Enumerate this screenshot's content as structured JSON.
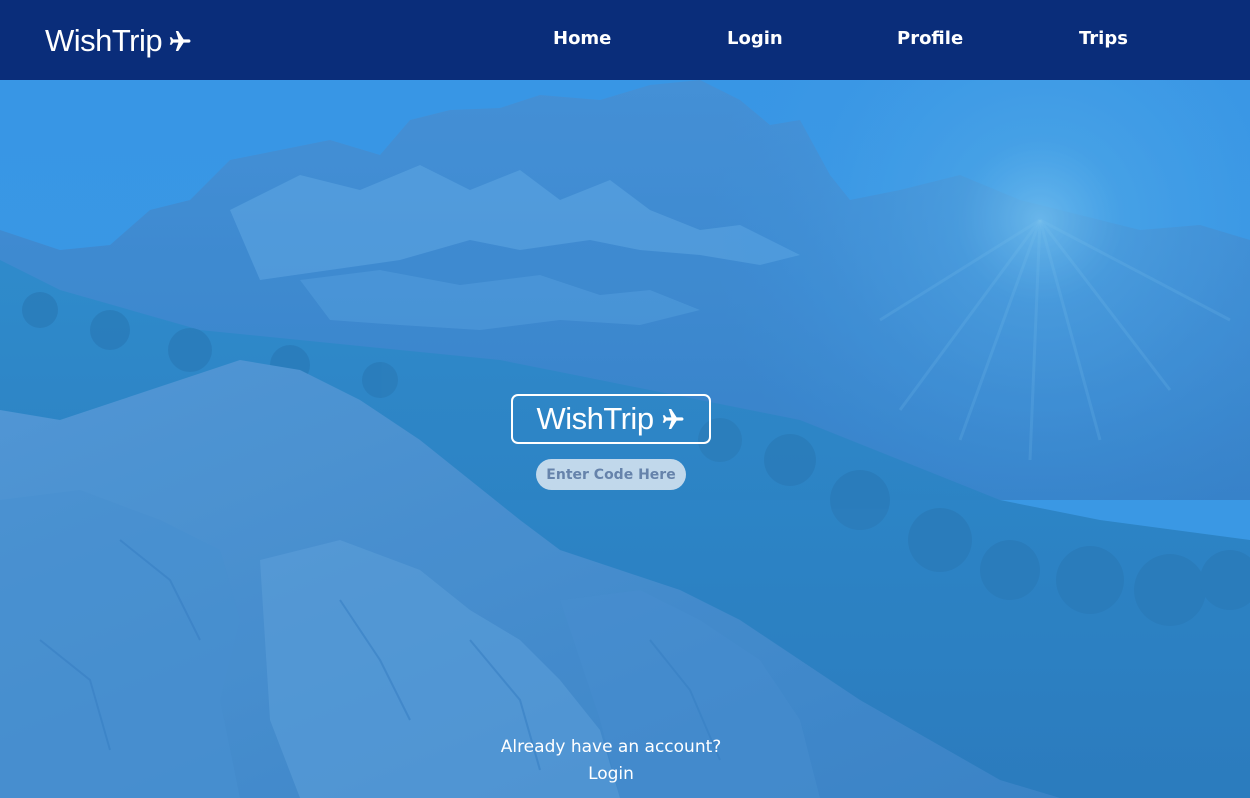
{
  "header": {
    "brand": "WishTrip",
    "brand_icon": "airplane-icon",
    "nav": [
      {
        "label": "Home"
      },
      {
        "label": "Login"
      },
      {
        "label": "Profile"
      },
      {
        "label": "Trips"
      }
    ]
  },
  "hero": {
    "background": "mountain landscape photo with blue overlay",
    "logo_text": "WishTrip",
    "code_input": {
      "placeholder": "Enter Code Here",
      "value": ""
    },
    "account_prompt": "Already have an account?",
    "login_link": "Login"
  },
  "colors": {
    "navbar": "#0a2d7a",
    "overlay": "#3a8fd6",
    "text": "#ffffff"
  }
}
